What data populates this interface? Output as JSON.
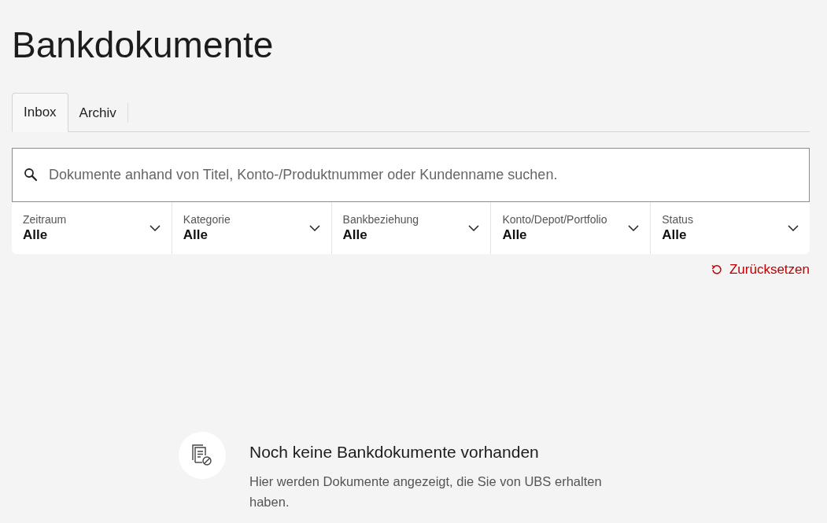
{
  "title": "Bankdokumente",
  "tabs": [
    {
      "label": "Inbox",
      "selected": true
    },
    {
      "label": "Archiv",
      "selected": false
    }
  ],
  "search": {
    "placeholder": "Dokumente anhand von Titel, Konto-/Produktnummer oder Kundenname suchen."
  },
  "filters": [
    {
      "label": "Zeitraum",
      "value": "Alle"
    },
    {
      "label": "Kategorie",
      "value": "Alle"
    },
    {
      "label": "Bankbeziehung",
      "value": "Alle"
    },
    {
      "label": "Konto/Depot/Portfolio",
      "value": "Alle"
    },
    {
      "label": "Status",
      "value": "Alle"
    }
  ],
  "reset_link": "Zurücksetzen",
  "empty_state": {
    "title": "Noch keine Bankdokumente vorhanden",
    "text": "Hier werden Dokumente angezeigt, die Sie von UBS erhalten haben."
  }
}
